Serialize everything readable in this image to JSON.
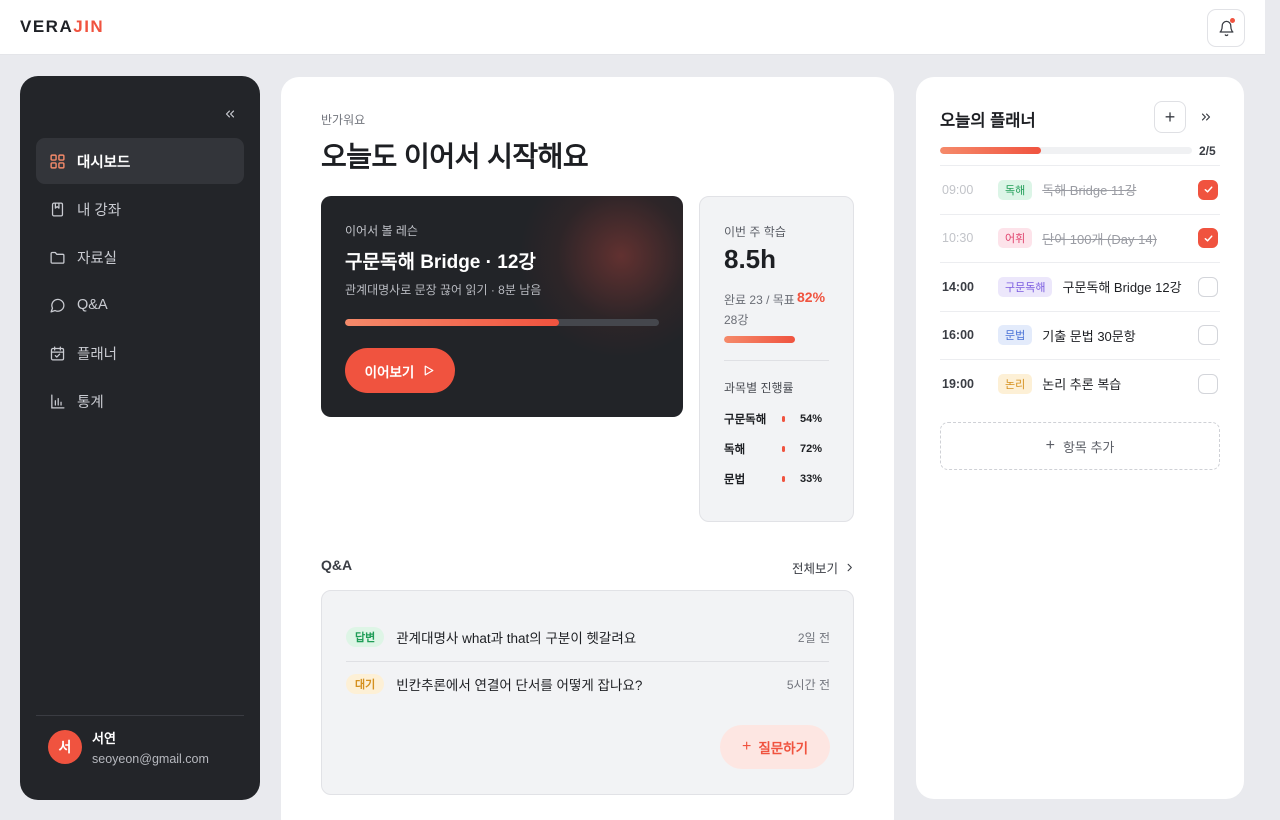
{
  "app": {
    "logo_main": "VERA",
    "logo_accent": "JIN",
    "accent_color": "#f0533f"
  },
  "sidebar": {
    "items": [
      {
        "label": "대시보드",
        "icon": "grid-icon",
        "active": true
      },
      {
        "label": "내 강좌",
        "icon": "bookmark-book-icon",
        "active": false
      },
      {
        "label": "자료실",
        "icon": "folder-icon",
        "active": false
      },
      {
        "label": "Q&A",
        "icon": "chat-bubble-icon",
        "active": false
      },
      {
        "label": "플래너",
        "icon": "calendar-check-icon",
        "active": false
      },
      {
        "label": "통계",
        "icon": "bar-chart-icon",
        "active": false
      }
    ],
    "profile": {
      "initial": "서",
      "name": "서연",
      "email": "seoyeon@gmail.com"
    }
  },
  "main": {
    "greeting_small": "반가워요",
    "greeting_title": "오늘도 이어서 시작해요",
    "resume": {
      "label": "이어서 볼 레슨",
      "title": "구문독해 Bridge · 12강",
      "subtitle": "관계대명사로 문장 끊어 읽기 · 8분 남음",
      "progress_percent": 68,
      "button_label": "이어보기"
    },
    "weekly": {
      "label": "이번 주 학습",
      "hours": "8.5h",
      "done_text": "완료 23 / 목표 28강",
      "done_percent_text": "82%",
      "done_percent": 82,
      "subjects_label": "과목별 진행률",
      "subjects": [
        {
          "name": "구문독해",
          "percent_text": "54%"
        },
        {
          "name": "독해",
          "percent_text": "72%"
        },
        {
          "name": "문법",
          "percent_text": "33%"
        }
      ]
    },
    "qa": {
      "heading": "Q&A",
      "view_all": "전체보기",
      "items": [
        {
          "status": "답변",
          "status_type": "answered",
          "question": "관계대명사 what과 that의 구분이 헷갈려요",
          "time": "2일 전"
        },
        {
          "status": "대기",
          "status_type": "waiting",
          "question": "빈칸추론에서 연결어 단서를 어떻게 잡나요?",
          "time": "5시간 전"
        }
      ],
      "ask_button": "질문하기"
    }
  },
  "planner": {
    "title": "오늘의 플래너",
    "progress_text": "2/5",
    "progress_fraction": 0.4,
    "items": [
      {
        "time": "09:00",
        "tag": "독해",
        "tag_bg": "#dcf5e7",
        "tag_color": "#1f9d57",
        "text": "독해 Bridge 11강",
        "done": true
      },
      {
        "time": "10:30",
        "tag": "어휘",
        "tag_bg": "#fde3ea",
        "tag_color": "#e0426d",
        "text": "단어 100개 (Day 14)",
        "done": true
      },
      {
        "time": "14:00",
        "tag": "구문독해",
        "tag_bg": "#ece7fb",
        "tag_color": "#7a5be0",
        "text": "구문독해 Bridge 12강",
        "done": false
      },
      {
        "time": "16:00",
        "tag": "문법",
        "tag_bg": "#e3ebfb",
        "tag_color": "#4a72d6",
        "text": "기출 문법 30문항",
        "done": false
      },
      {
        "time": "19:00",
        "tag": "논리",
        "tag_bg": "#fdf0d6",
        "tag_color": "#d5901d",
        "text": "논리 추론 복습",
        "done": false
      }
    ],
    "add_item_label": "항목 추가"
  }
}
